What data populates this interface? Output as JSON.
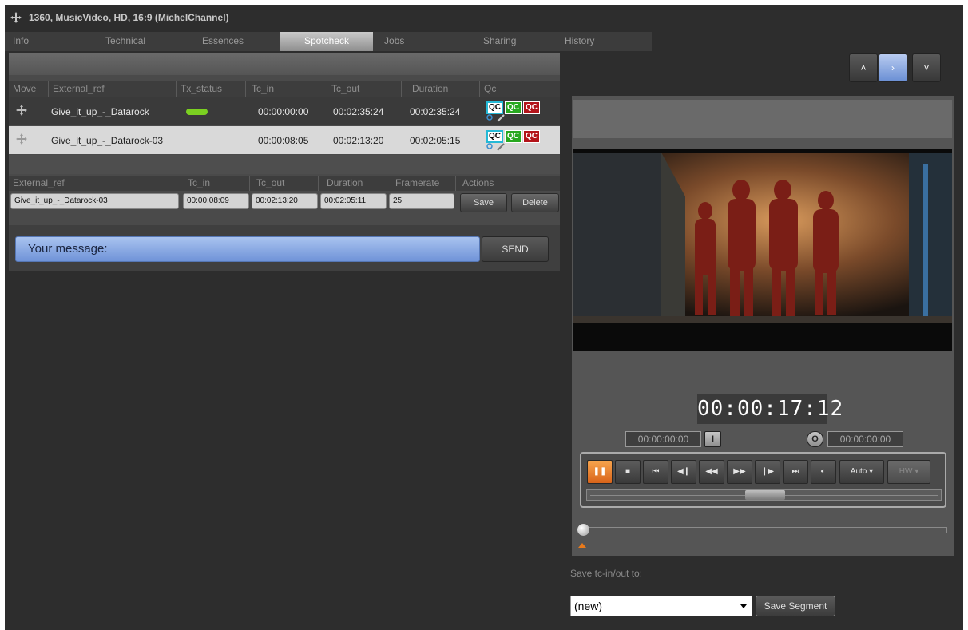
{
  "window": {
    "title": "1360, MusicVideo, HD, 16:9 (MichelChannel)"
  },
  "tabs": [
    {
      "label": "Info"
    },
    {
      "label": "Technical"
    },
    {
      "label": "Essences"
    },
    {
      "label": "Spotcheck"
    },
    {
      "label": "Jobs"
    },
    {
      "label": "Sharing"
    },
    {
      "label": "History"
    }
  ],
  "spotcheck": {
    "columns": [
      "Move",
      "External_ref",
      "Tx_status",
      "Tc_in",
      "Tc_out",
      "Duration",
      "Qc"
    ],
    "rows": [
      {
        "external_ref": "Give_it_up_-_Datarock",
        "tc_in": "00:00:00:00",
        "tc_out": "00:02:35:24",
        "duration": "00:02:35:24",
        "status_color": "#7bd021"
      },
      {
        "external_ref": "Give_it_up_-_Datarock-03",
        "tc_in": "00:00:08:05",
        "tc_out": "00:02:13:20",
        "duration": "00:02:05:15"
      }
    ],
    "qc_badges": [
      "QC",
      "QC",
      "QC"
    ]
  },
  "segment": {
    "columns": [
      "External_ref",
      "Tc_in",
      "Tc_out",
      "Duration",
      "Framerate",
      "Actions"
    ],
    "external_ref": "Give_it_up_-_Datarock-03",
    "tc_in": "00:00:08:09",
    "tc_out": "00:02:13:20",
    "duration": "00:02:05:11",
    "framerate": "25",
    "save_label": "Save",
    "delete_label": "Delete"
  },
  "message": {
    "placeholder": "Your message:",
    "send_label": "SEND"
  },
  "nav": {
    "up": "˄",
    "next": "›",
    "down": "˅"
  },
  "player": {
    "timecode": "00:00:17:12",
    "mark_in": "00:00:00:00",
    "mark_out": "00:00:00:00",
    "mark_in_btn": "I",
    "mark_out_btn": "O",
    "auto_label": "Auto",
    "hw_label": "HW",
    "scrub_position": 0.5,
    "timeline_position": 0.0
  },
  "save_to": {
    "label": "Save tc-in/out to:",
    "selected": "(new)",
    "button": "Save Segment"
  },
  "colors": {
    "accent_blue": "#6f93d8",
    "play_orange": "#e8761d",
    "qc_green": "#28a81f",
    "qc_red": "#b3141a",
    "qc_cyan": "#24b9d6"
  }
}
